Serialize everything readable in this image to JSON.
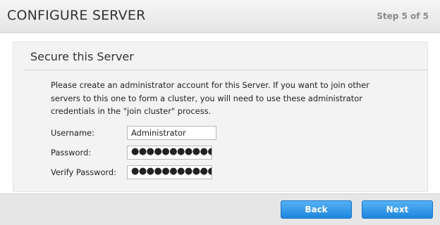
{
  "header": {
    "title": "CONFIGURE SERVER",
    "step": "Step 5 of 5"
  },
  "section": {
    "title": "Secure this Server",
    "intro": "Please create an administrator account for this Server. If you want to join other servers to this one to form a cluster, you will need to use these administrator credentials in the \"join cluster\" process."
  },
  "form": {
    "username_label": "Username:",
    "username_value": "Administrator",
    "password_label": "Password:",
    "password_value": "●●●●●●●●●●●",
    "verify_label": "Verify Password:",
    "verify_value": "●●●●●●●●●●●",
    "reveal_icon": "eye-icon"
  },
  "footer": {
    "back_label": "Back",
    "next_label": "Next"
  },
  "colors": {
    "button_top": "#55b1f5",
    "button_bottom": "#1e86de"
  }
}
